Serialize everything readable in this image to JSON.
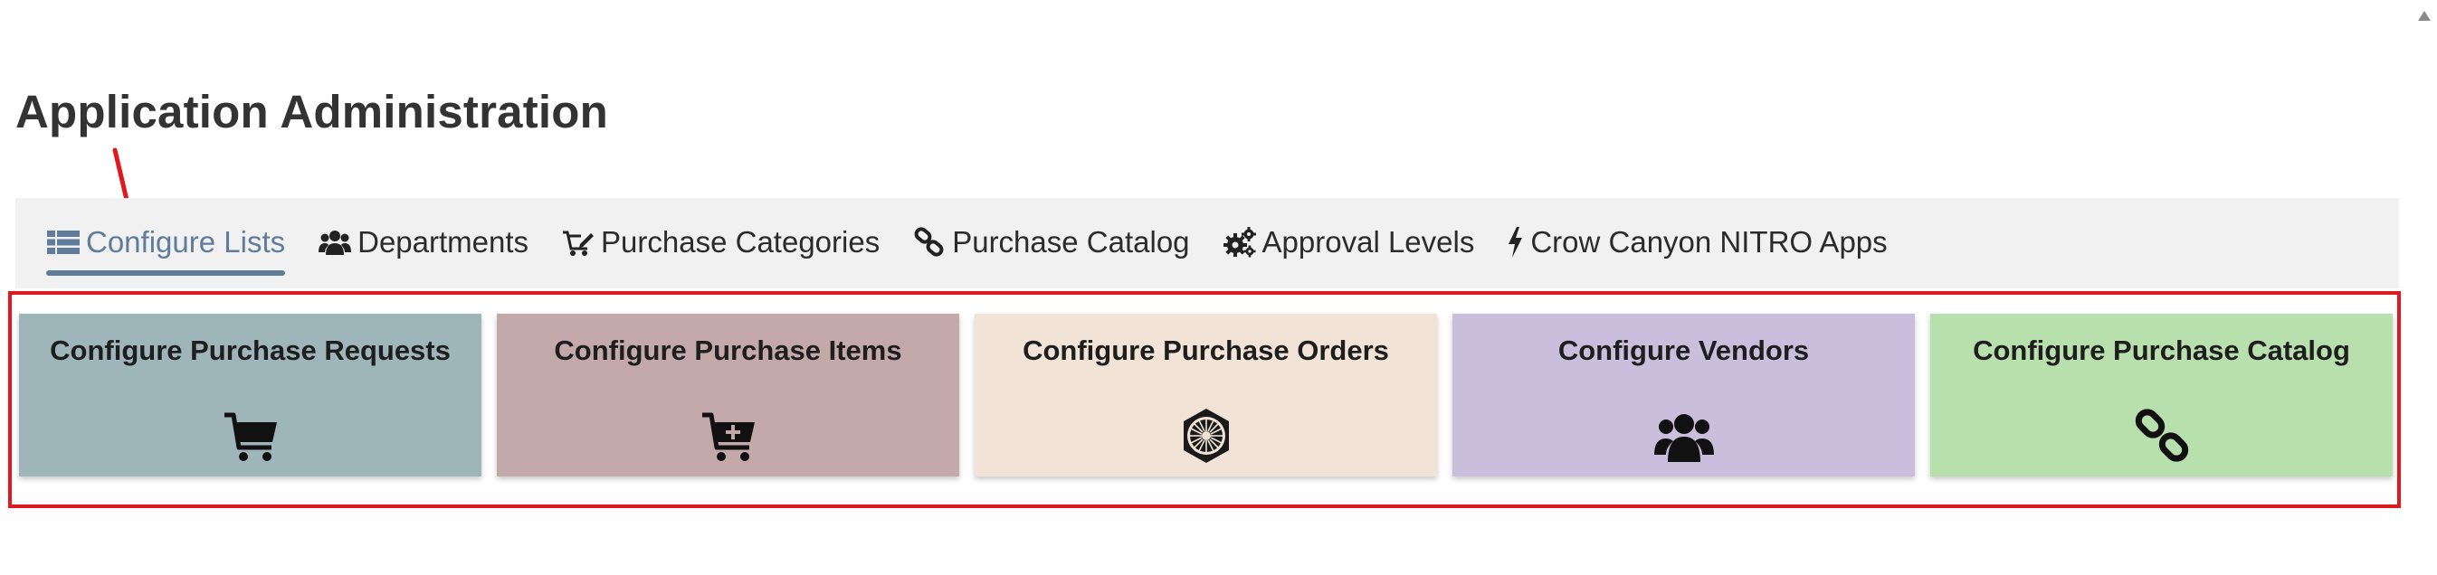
{
  "page": {
    "title": "Application Administration"
  },
  "tabs": [
    {
      "label": "Configure Lists",
      "icon": "list-icon",
      "active": true
    },
    {
      "label": "Departments",
      "icon": "users-icon"
    },
    {
      "label": "Purchase Categories",
      "icon": "cart-edit-icon"
    },
    {
      "label": "Purchase Catalog",
      "icon": "link-icon"
    },
    {
      "label": "Approval Levels",
      "icon": "gears-icon"
    },
    {
      "label": "Crow Canyon NITRO Apps",
      "icon": "bolt-icon"
    }
  ],
  "cards": [
    {
      "title": "Configure Purchase Requests",
      "icon": "cart-icon",
      "color": "#9eb5b9"
    },
    {
      "title": "Configure Purchase Items",
      "icon": "cart-plus-icon",
      "color": "#c4a9aa"
    },
    {
      "title": "Configure Purchase Orders",
      "icon": "emblem-icon",
      "color": "#f1e3d6"
    },
    {
      "title": "Configure Vendors",
      "icon": "users-icon",
      "color": "#c9bfdd"
    },
    {
      "title": "Configure Purchase Catalog",
      "icon": "link-icon",
      "color": "#b8e0ad"
    }
  ],
  "colors": {
    "accent": "#5f7d9b",
    "highlight": "#e1191f",
    "tabbar": "#f1f1f1"
  }
}
